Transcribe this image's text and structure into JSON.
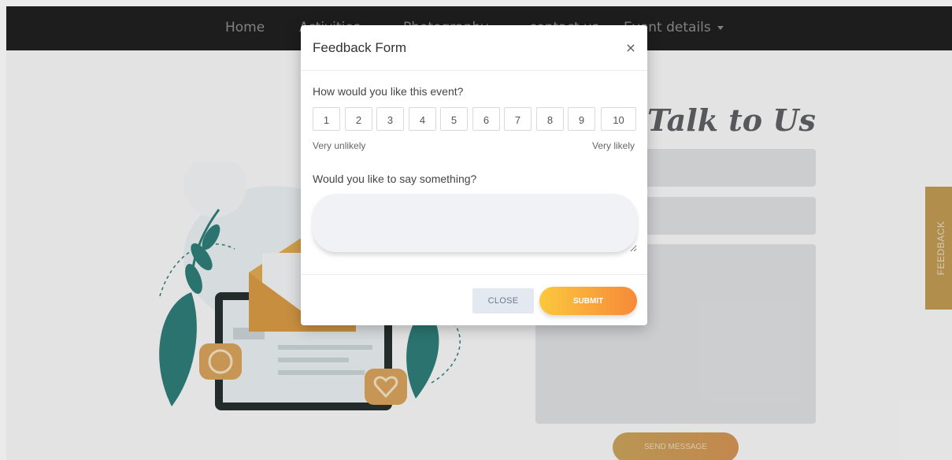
{
  "navbar": {
    "items": [
      {
        "label": "Home"
      },
      {
        "label": "Activities"
      },
      {
        "label": "Photography"
      },
      {
        "label": "contact us"
      },
      {
        "label": "Event details"
      }
    ]
  },
  "contact": {
    "title": "Talk to Us",
    "send_label": "SEND MESSAGE"
  },
  "feedback_tab": {
    "label": "FEEDBACK"
  },
  "modal": {
    "title": "Feedback Form",
    "close_icon": "×",
    "question1": "How would you like this event?",
    "ratings": [
      "1",
      "2",
      "3",
      "4",
      "5",
      "6",
      "7",
      "8",
      "9",
      "10"
    ],
    "scale_low": "Very unlikely",
    "scale_high": "Very likely",
    "question2": "Would you like to say something?",
    "comment_value": "",
    "close_label": "CLOSE",
    "submit_label": "SUBMIT"
  },
  "colors": {
    "navbar": "#202021",
    "submit_start": "#fbc83c",
    "submit_end": "#f7893a",
    "feedback_tab": "#c29b54"
  }
}
